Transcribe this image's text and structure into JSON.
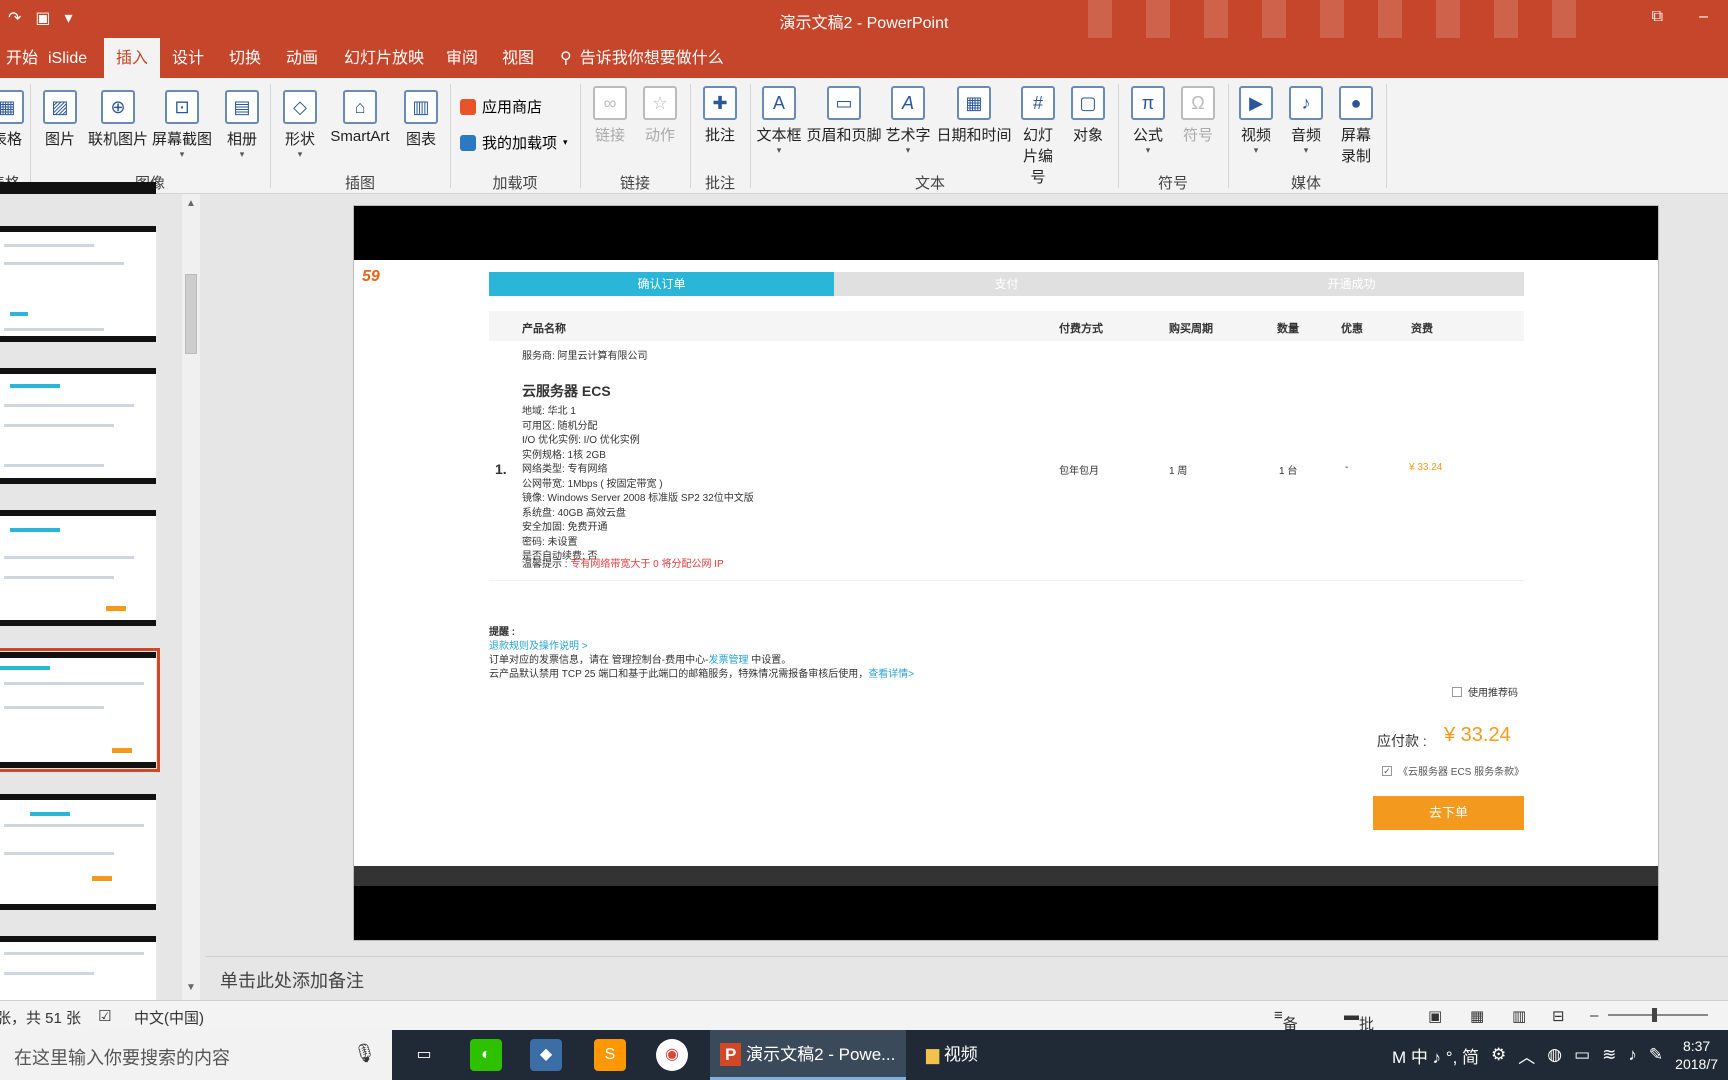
{
  "window": {
    "title": "演示文稿2 - PowerPoint"
  },
  "menu": {
    "tabs": [
      "开始",
      "iSlide",
      "插入",
      "设计",
      "切换",
      "动画",
      "幻灯片放映",
      "审阅",
      "视图"
    ],
    "active": "插入",
    "tellme": "告诉我你想要做什么"
  },
  "ribbon": {
    "table": {
      "label": "表格",
      "group": "表格"
    },
    "images": {
      "items": [
        "图片",
        "联机图片",
        "屏幕截图",
        "相册"
      ],
      "group": "图像"
    },
    "illustrations": {
      "items": [
        "形状",
        "SmartArt",
        "图表"
      ],
      "group": "插图"
    },
    "addins": {
      "store": "应用商店",
      "myaddins": "我的加载项",
      "group": "加载项"
    },
    "links": {
      "items": [
        "链接",
        "动作"
      ],
      "group": "链接"
    },
    "comments": {
      "item": "批注",
      "group": "批注"
    },
    "text": {
      "items": [
        "文本框",
        "页眉和页脚",
        "艺术字",
        "日期和时间",
        "幻灯片编号",
        "对象"
      ],
      "group": "文本"
    },
    "symbols": {
      "items": [
        "公式",
        "符号"
      ],
      "group": "符号"
    },
    "media": {
      "items": [
        "视频",
        "音频",
        "屏幕录制"
      ],
      "group": "媒体"
    }
  },
  "slide": {
    "logo": "59",
    "steps": [
      "确认订单",
      "支付",
      "开通成功"
    ],
    "headers": [
      "产品名称",
      "付费方式",
      "购买周期",
      "数量",
      "优惠",
      "资费"
    ],
    "vendor": "服务商: 阿里云计算有限公司",
    "product": "云服务器 ECS",
    "index": "1.",
    "specs": [
      "地域:    华北 1",
      "可用区:    随机分配",
      "I/O 优化实例:    I/O 优化实例",
      "实例规格:    1核 2GB",
      "网络类型:    专有网络",
      "公网带宽:    1Mbps ( 按固定带宽 )",
      "镜像:    Windows Server 2008 标准版 SP2 32位中文版",
      "系统盘:    40GB 高效云盘",
      "安全加固:    免费开通",
      "密码:    未设置",
      "是否自动续费:    否"
    ],
    "pay_method": "包年包月",
    "period": "1 周",
    "quantity": "1 台",
    "discount": "-",
    "fee": "¥ 33.24",
    "hint_prefix": "温馨提示 : ",
    "hint_red": "专有网络带宽大于 0 将分配公网 IP",
    "notes_title": "提醒 :",
    "notes_link": "退款规则及操作说明 >",
    "notes_line1_a": "订单对应的发票信息，请在 管理控制台-费用中心-",
    "notes_line1_link": "发票管理",
    "notes_line1_b": " 中设置。",
    "notes_line2": "云产品默认禁用 TCP 25 端口和基于此端口的邮箱服务，特殊情况需报备审核后使用，",
    "notes_line2_link": "查看详情>",
    "coupon": "使用推荐码",
    "pay_label": "应付款 :",
    "pay_amount": "¥ 33.24",
    "terms": "《云服务器 ECS 服务条款》",
    "order_button": "去下单"
  },
  "notes_placeholder": "单击此处添加备注",
  "status": {
    "slide_count": "张，共 51 张",
    "language": "中文(中国)",
    "notes_btn": "备注",
    "comments_btn": "批注"
  },
  "taskbar": {
    "search_placeholder": "在这里输入你要搜索的内容",
    "apps": [
      "演示文稿2 - Powe...",
      "视频"
    ],
    "ime": "M 中 ♪ °, 简",
    "time": "8:37",
    "date": "2018/7"
  },
  "colors": {
    "accent": "#c5462a",
    "step_active": "#29b6d8",
    "order_button": "#f39a1e"
  }
}
